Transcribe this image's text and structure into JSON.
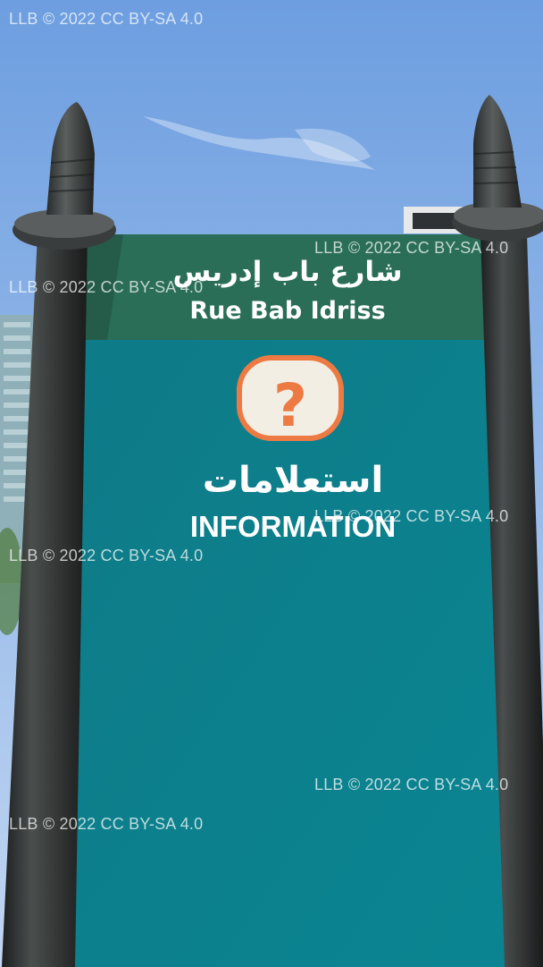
{
  "sign": {
    "street_name_arabic": "شارع باب إدريس",
    "street_name_latin": "Rue Bab Idriss",
    "info_icon_glyph": "?",
    "info_label_arabic": "استعلامات",
    "info_label_latin": "INFORMATION"
  },
  "icons": {
    "info": "question-mark-icon"
  },
  "watermarks": [
    "LLB © 2022 CC BY-SA 4.0",
    "LLB © 2022 CC BY-SA 4.0",
    "LLB © 2022 CC BY-SA 4.0",
    "LLB © 2022 CC BY-SA 4.0",
    "LLB © 2022 CC BY-SA 4.0",
    "LLB © 2022 CC BY-SA 4.0",
    "LLB © 2022 CC BY-SA 4.0"
  ],
  "colors": {
    "sky_top": "#6f9fe0",
    "sky_bottom": "#b9d0f0",
    "header_green": "#2a6f58",
    "panel_teal": "#0c7d86",
    "pole_dark": "#2c2f2e",
    "icon_orange": "#ef7a45",
    "icon_fill": "#f6efe4"
  }
}
